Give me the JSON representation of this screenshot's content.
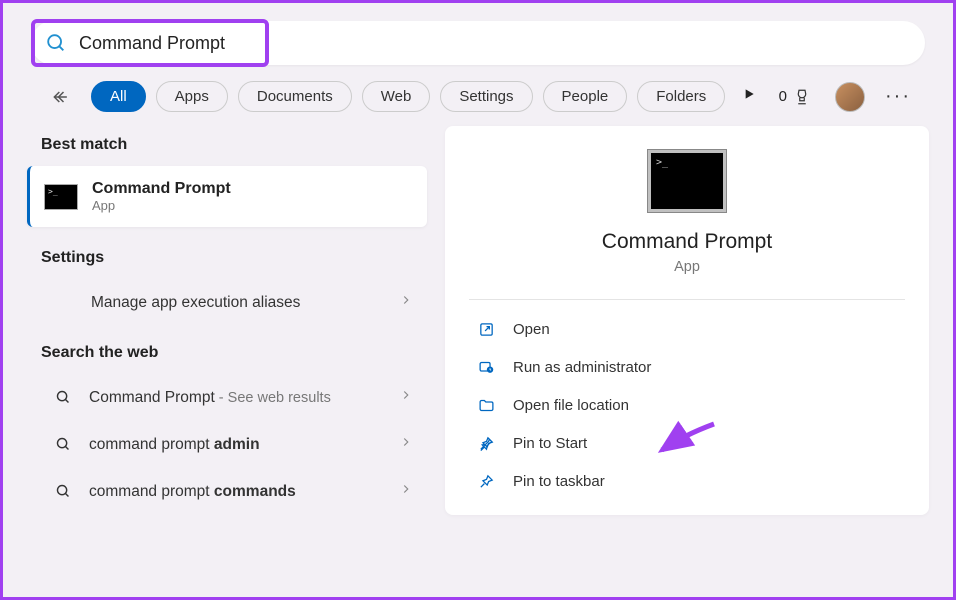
{
  "search": {
    "value": "Command Prompt"
  },
  "filters": {
    "items": [
      "All",
      "Apps",
      "Documents",
      "Web",
      "Settings",
      "People",
      "Folders"
    ],
    "active": 0
  },
  "points": {
    "value": "0"
  },
  "left": {
    "best_match_header": "Best match",
    "best_match": {
      "title": "Command Prompt",
      "subtitle": "App"
    },
    "settings_header": "Settings",
    "settings_items": [
      {
        "label": "Manage app execution aliases"
      }
    ],
    "web_header": "Search the web",
    "web_items": [
      {
        "prefix": "Command Prompt",
        "bold": "",
        "hint": " - See web results"
      },
      {
        "prefix": "command prompt ",
        "bold": "admin",
        "hint": ""
      },
      {
        "prefix": "command prompt ",
        "bold": "commands",
        "hint": ""
      }
    ]
  },
  "right": {
    "title": "Command Prompt",
    "subtitle": "App",
    "actions": [
      {
        "icon": "open",
        "label": "Open"
      },
      {
        "icon": "admin",
        "label": "Run as administrator"
      },
      {
        "icon": "folder",
        "label": "Open file location"
      },
      {
        "icon": "pin-start",
        "label": "Pin to Start"
      },
      {
        "icon": "pin-taskbar",
        "label": "Pin to taskbar"
      }
    ]
  }
}
